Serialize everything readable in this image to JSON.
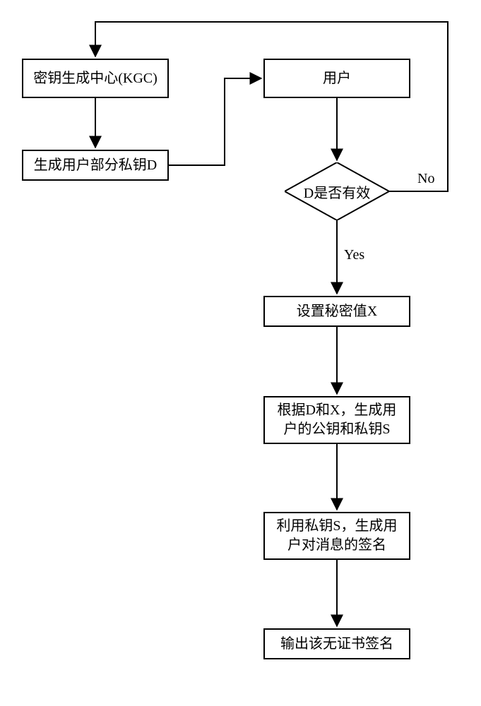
{
  "flow": {
    "kgc": "密钥生成中心(KGC)",
    "gen_d": "生成用户部分私钥D",
    "user": "用户",
    "check_d": "D是否有效",
    "yes": "Yes",
    "no": "No",
    "set_x": "设置秘密值X",
    "gen_keys": "根据D和X，生成用\n户的公钥和私钥S",
    "sign": "利用私钥S，生成用\n户对消息的签名",
    "output": "输出该无证书签名"
  }
}
